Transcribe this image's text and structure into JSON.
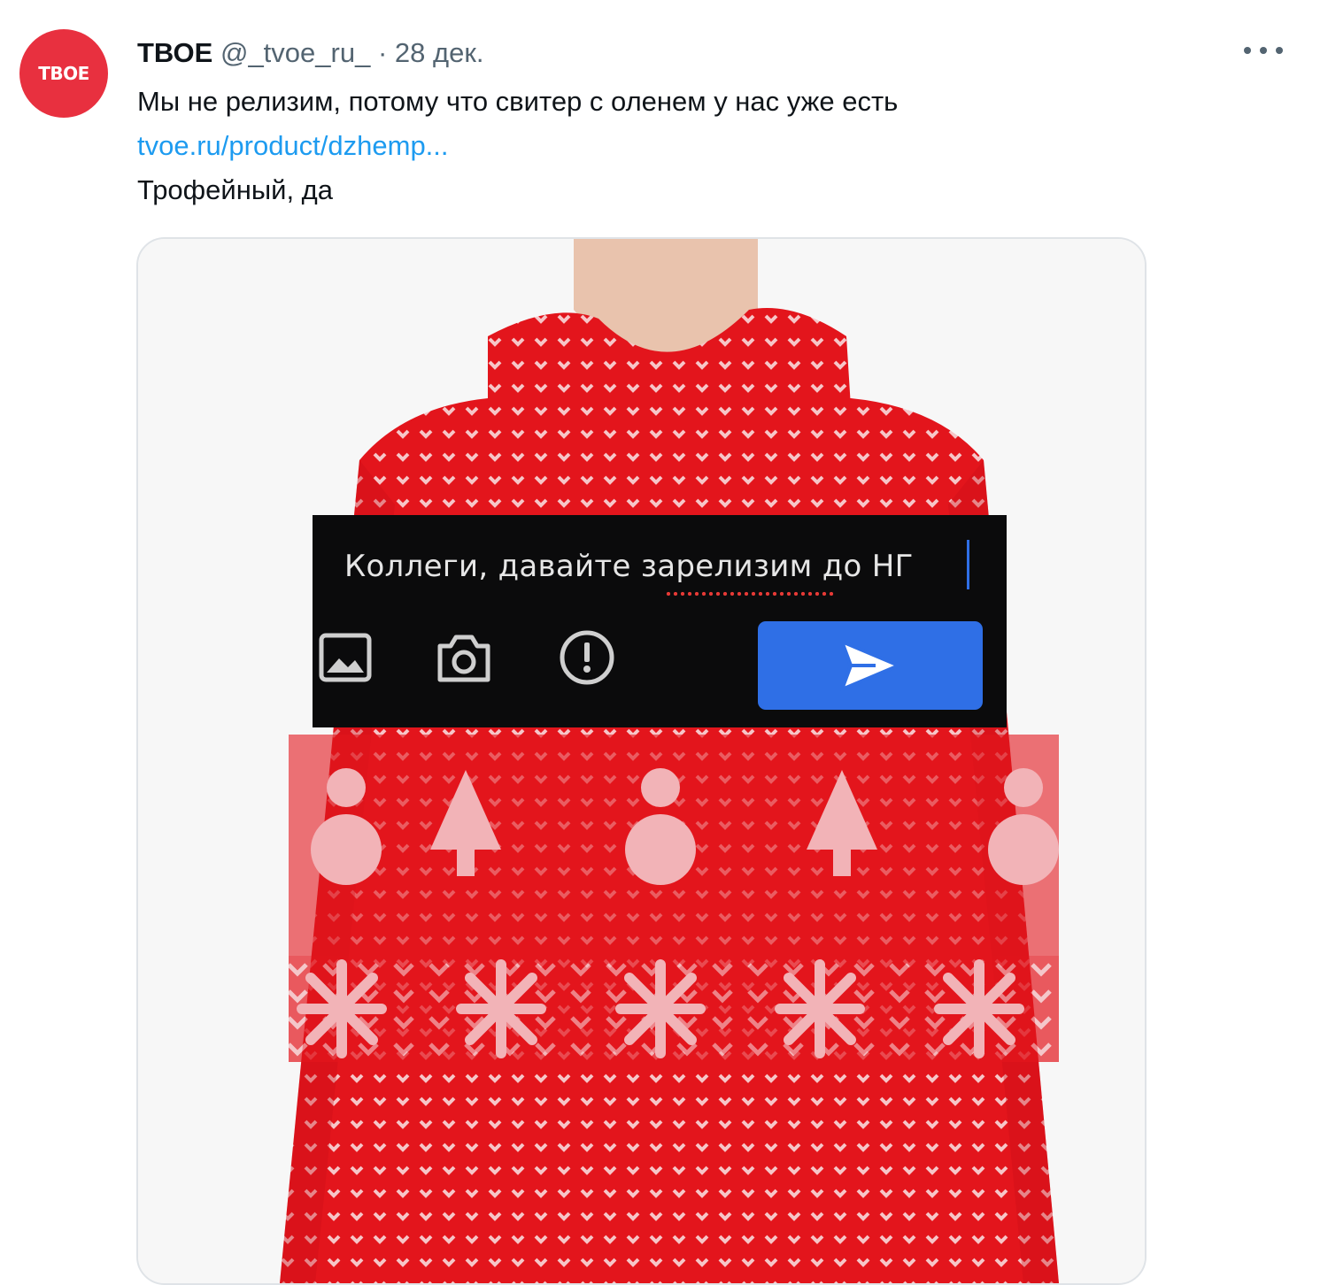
{
  "tweet": {
    "avatar_text": "ТВОЕ",
    "author_name": "ТВОЕ",
    "author_handle": "@_tvoe_ru_",
    "separator": "·",
    "date": "28 дек.",
    "text_line_1": "Мы не релизим, потому что свитер с оленем у нас уже есть",
    "link_text": "tvoe.ru/product/dzhemp...",
    "text_line_3": "Трофейный, да"
  },
  "composer": {
    "message_text": "Коллеги, давайте зарелизим до НГ",
    "icons": [
      "image-icon",
      "camera-icon",
      "alert-icon",
      "send-icon"
    ],
    "send_color": "#2f6fe6"
  },
  "colors": {
    "brand_red": "#e8303f",
    "link_blue": "#1d9bf0",
    "secondary_text": "#536471",
    "sweater_red": "#e3151c"
  }
}
